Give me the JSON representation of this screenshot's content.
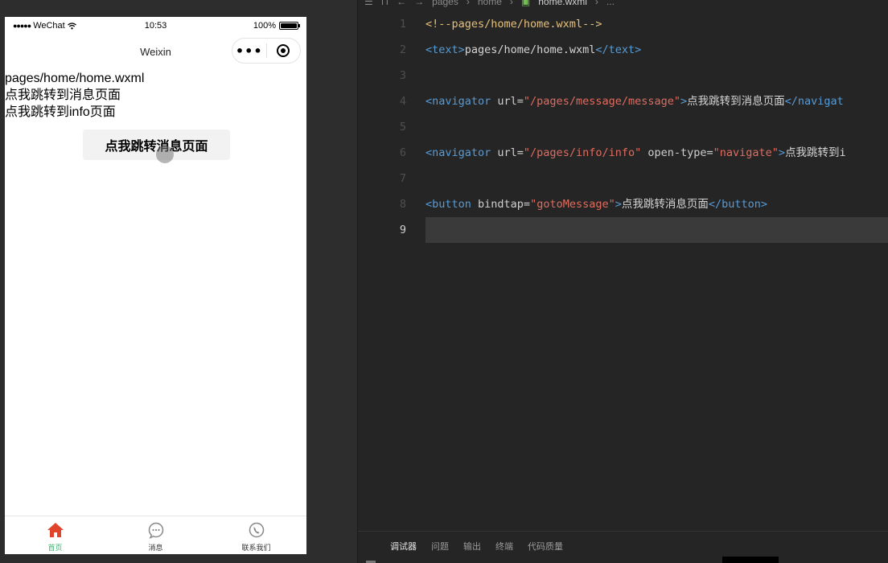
{
  "simulator": {
    "status_bar": {
      "signal": "●●●●●",
      "carrier": "WeChat",
      "time": "10:53",
      "battery": "100%",
      "battery_level": 1.0
    },
    "nav_bar": {
      "title": "Weixin"
    },
    "content": {
      "lines": [
        "pages/home/home.wxml",
        "点我跳转到消息页面",
        "点我跳转到info页面"
      ],
      "button_label": "点我跳转消息页面"
    },
    "tab_bar": {
      "items": [
        {
          "label": "首页",
          "icon": "home-icon",
          "active": true
        },
        {
          "label": "消息",
          "icon": "message-icon",
          "active": false
        },
        {
          "label": "联系我们",
          "icon": "phone-icon",
          "active": false
        }
      ]
    },
    "colors": {
      "tab_active": "#3cb371",
      "home_icon": "#e0442a"
    }
  },
  "editor": {
    "breadcrumbs": [
      "pages",
      "home",
      "home.wxml",
      "..."
    ],
    "current_line": 9,
    "lines": [
      {
        "n": "1",
        "tokens": [
          {
            "t": "<!--pages/home/home.wxml-->",
            "c": "comment"
          }
        ]
      },
      {
        "n": "2",
        "tokens": [
          {
            "t": "<text>",
            "c": "tag"
          },
          {
            "t": "pages/home/home.wxml",
            "c": "plain"
          },
          {
            "t": "</text>",
            "c": "tag"
          }
        ]
      },
      {
        "n": "3",
        "tokens": []
      },
      {
        "n": "4",
        "tokens": [
          {
            "t": "<navigator",
            "c": "tag"
          },
          {
            "t": " url=",
            "c": "attr"
          },
          {
            "t": "\"/pages/message/message\"",
            "c": "str"
          },
          {
            "t": ">",
            "c": "tag"
          },
          {
            "t": "点我跳转到消息页面",
            "c": "plain"
          },
          {
            "t": "</navigat",
            "c": "tag"
          }
        ]
      },
      {
        "n": "5",
        "tokens": []
      },
      {
        "n": "6",
        "tokens": [
          {
            "t": "<navigator",
            "c": "tag"
          },
          {
            "t": " url=",
            "c": "attr"
          },
          {
            "t": "\"/pages/info/info\"",
            "c": "str"
          },
          {
            "t": " open-type=",
            "c": "attr"
          },
          {
            "t": "\"navigate\"",
            "c": "str"
          },
          {
            "t": ">",
            "c": "tag"
          },
          {
            "t": "点我跳转到i",
            "c": "plain"
          }
        ]
      },
      {
        "n": "7",
        "tokens": []
      },
      {
        "n": "8",
        "tokens": [
          {
            "t": "<button",
            "c": "tag"
          },
          {
            "t": " bindtap=",
            "c": "attr"
          },
          {
            "t": "\"gotoMessage\"",
            "c": "str"
          },
          {
            "t": ">",
            "c": "tag"
          },
          {
            "t": "点我跳转消息页面",
            "c": "plain"
          },
          {
            "t": "</button>",
            "c": "tag"
          }
        ]
      },
      {
        "n": "9",
        "tokens": []
      }
    ],
    "bottom_tabs": [
      "调试器",
      "问题",
      "输出",
      "终端",
      "代码质量"
    ],
    "active_bottom_tab": "调试器"
  }
}
